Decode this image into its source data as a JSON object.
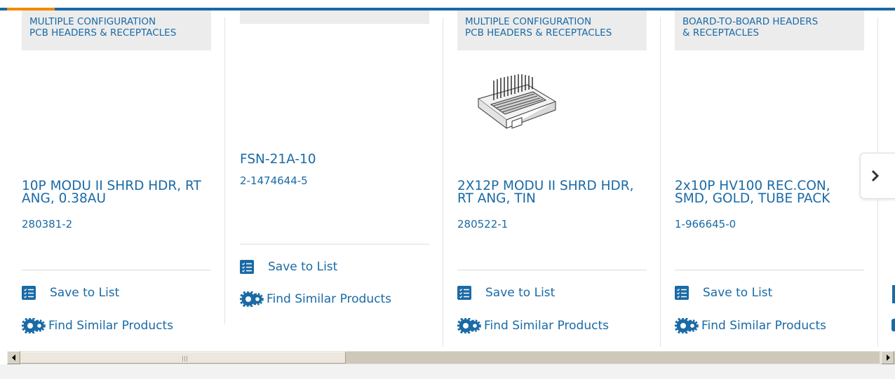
{
  "colors": {
    "brand_blue": "#1a6aa6",
    "accent_orange": "#f28a00",
    "tag_bg": "#ececec"
  },
  "cards": [
    {
      "category": "MULTIPLE CONFIGURATION\nPCB HEADERS & RECEPTACLES",
      "title": "10P MODU II SHRD HDR, RT ANG, 0.38AU",
      "part_number": "280381-2",
      "save_label": "Save to List",
      "similar_label": "Find Similar Products",
      "has_image": false
    },
    {
      "category": "",
      "title": "FSN-21A-10",
      "part_number": "2-1474644-5",
      "save_label": "Save to List",
      "similar_label": "Find Similar Products",
      "has_image": false
    },
    {
      "category": "MULTIPLE CONFIGURATION\nPCB HEADERS & RECEPTACLES",
      "title": "2X12P MODU II SHRD HDR, RT ANG, TIN",
      "part_number": "280522-1",
      "save_label": "Save to List",
      "similar_label": "Find Similar Products",
      "has_image": true,
      "image_icon": "connector-header-image"
    },
    {
      "category": "BOARD-TO-BOARD HEADERS\n& RECEPTACLES",
      "title": "2x10P HV100 REC.CON, SMD, GOLD, TUBE PACK",
      "part_number": "1-966645-0",
      "save_label": "Save to List",
      "similar_label": "Find Similar Products",
      "has_image": false
    }
  ],
  "carousel": {
    "next_icon": "chevron-right-icon"
  },
  "scrollbar": {
    "left_icon": "arrow-left-icon",
    "right_icon": "arrow-right-icon",
    "position_fraction": 0.0
  }
}
